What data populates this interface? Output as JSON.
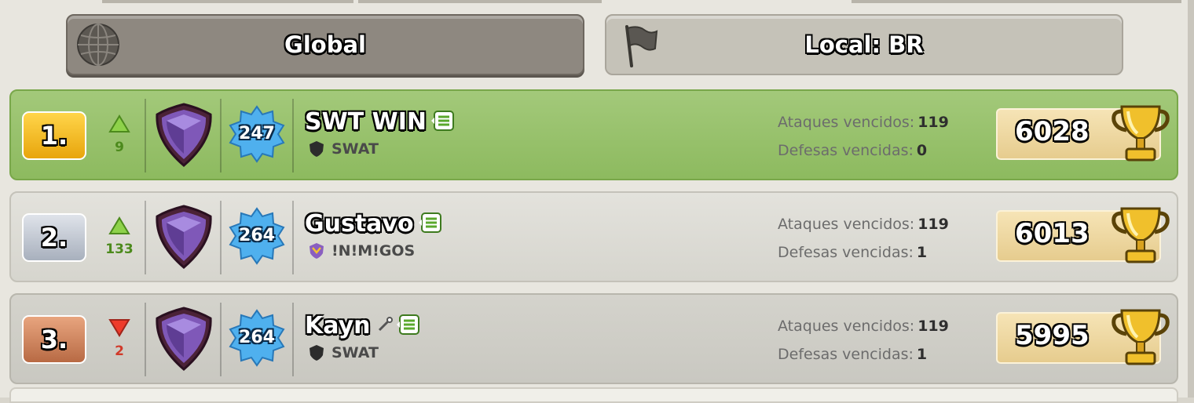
{
  "tabs": {
    "global_label": "Global",
    "local_label": "Local: BR"
  },
  "colors": {
    "first_row": "#9cc46f",
    "rank_gold": "#f3bb22",
    "rank_silver": "#c3c9d3",
    "rank_bronze": "#d28a62",
    "change_up": "#4c8a1c",
    "change_down": "#d13a2a"
  },
  "rows": [
    {
      "rank": "1.",
      "change": "9",
      "change_dir": "up",
      "xp_level": "247",
      "name": "SWT WIN",
      "clan": "SWAT",
      "attacks_label": "Ataques vencidos:",
      "attacks": "119",
      "defenses_label": "Defesas vencidas:",
      "defenses": "0",
      "trophies": "6028"
    },
    {
      "rank": "2.",
      "change": "133",
      "change_dir": "up",
      "xp_level": "264",
      "name": "Gustavo",
      "clan": "!N!M!GOS",
      "attacks_label": "Ataques vencidos:",
      "attacks": "119",
      "defenses_label": "Defesas vencidas:",
      "defenses": "1",
      "trophies": "6013"
    },
    {
      "rank": "3.",
      "change": "2",
      "change_dir": "down",
      "xp_level": "264",
      "name": "Kayn",
      "clan": "SWAT",
      "attacks_label": "Ataques vencidos:",
      "attacks": "119",
      "defenses_label": "Defesas vencidas:",
      "defenses": "1",
      "trophies": "5995"
    }
  ]
}
